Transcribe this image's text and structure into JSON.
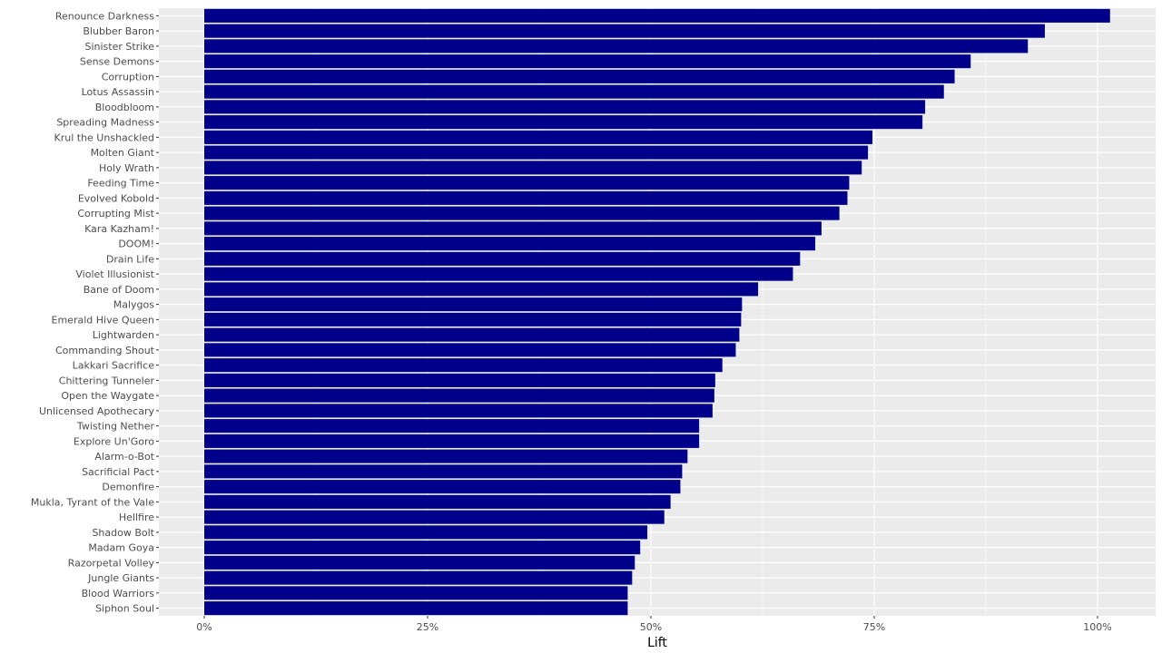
{
  "chart_data": {
    "type": "bar",
    "orientation": "horizontal",
    "title": "",
    "xlabel": "Lift",
    "ylabel": "",
    "xlim": [
      -0.05,
      1.07
    ],
    "xticks": [
      0,
      0.25,
      0.5,
      0.75,
      1.0
    ],
    "xtick_labels": [
      "0%",
      "25%",
      "50%",
      "75%",
      "100%"
    ],
    "grid": true,
    "legend": "none",
    "bar_color": "#00008B",
    "panel_color": "#EBEBEB",
    "categories": [
      "Renounce Darkness",
      "Blubber Baron",
      "Sinister Strike",
      "Sense Demons",
      "Corruption",
      "Lotus Assassin",
      "Bloodbloom",
      "Spreading Madness",
      "Krul the Unshackled",
      "Molten Giant",
      "Holy Wrath",
      "Feeding Time",
      "Evolved Kobold",
      "Corrupting Mist",
      "Kara Kazham!",
      "DOOM!",
      "Drain Life",
      "Violet Illusionist",
      "Bane of Doom",
      "Malygos",
      "Emerald Hive Queen",
      "Lightwarden",
      "Commanding Shout",
      "Lakkari Sacrifice",
      "Chittering Tunneler",
      "Open the Waygate",
      "Unlicensed Apothecary",
      "Twisting Nether",
      "Explore Un'Goro",
      "Alarm-o-Bot",
      "Sacrificial Pact",
      "Demonfire",
      "Mukla, Tyrant of the Vale",
      "Hellfire",
      "Shadow Bolt",
      "Madam Goya",
      "Razorpetal Volley",
      "Jungle Giants",
      "Blood Warriors",
      "Siphon Soul"
    ],
    "values": [
      1.014,
      0.941,
      0.922,
      0.858,
      0.84,
      0.828,
      0.807,
      0.804,
      0.748,
      0.743,
      0.736,
      0.722,
      0.72,
      0.711,
      0.691,
      0.684,
      0.667,
      0.659,
      0.62,
      0.602,
      0.601,
      0.599,
      0.595,
      0.58,
      0.572,
      0.571,
      0.569,
      0.554,
      0.554,
      0.541,
      0.535,
      0.533,
      0.522,
      0.515,
      0.496,
      0.488,
      0.482,
      0.479,
      0.474,
      0.474
    ]
  }
}
